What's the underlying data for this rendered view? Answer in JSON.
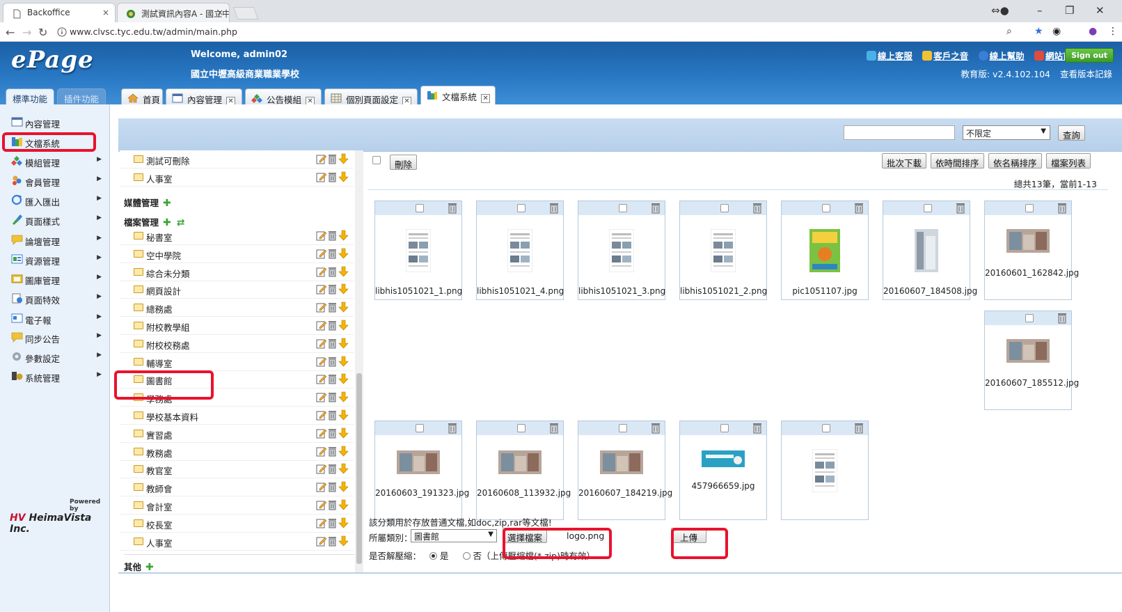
{
  "browser": {
    "tabs": [
      {
        "title": "Backoffice",
        "close": "×"
      },
      {
        "title": "測試資訊內容A - 國立中",
        "close": "×"
      }
    ],
    "url": "www.clvsc.tyc.edu.tw/admin/main.php"
  },
  "header": {
    "logo": "ePage",
    "welcome": "Welcome, admin02",
    "school": "國立中壢高級商業職業學校",
    "links": [
      "線上客服",
      "客戶之音",
      "線上幫助",
      "網站首頁"
    ],
    "signout": "Sign out",
    "version": "教育版: v2.4.102.104",
    "version_log": "查看版本記錄"
  },
  "side_tabs": [
    "標準功能",
    "插件功能"
  ],
  "work_tabs": [
    {
      "label": "首頁",
      "closable": false
    },
    {
      "label": "內容管理",
      "closable": true
    },
    {
      "label": "公告模組",
      "closable": true
    },
    {
      "label": "個別頁面設定",
      "closable": true
    },
    {
      "label": "文檔系統",
      "closable": true
    }
  ],
  "nav": [
    {
      "label": "內容管理",
      "arrow": false
    },
    {
      "label": "文檔系統",
      "arrow": false
    },
    {
      "label": "模組管理",
      "arrow": true
    },
    {
      "label": "會員管理",
      "arrow": true
    },
    {
      "label": "匯入匯出",
      "arrow": true
    },
    {
      "label": "頁面樣式",
      "arrow": true
    },
    {
      "label": "論壇管理",
      "arrow": true
    },
    {
      "label": "資源管理",
      "arrow": true
    },
    {
      "label": "圖庫管理",
      "arrow": true
    },
    {
      "label": "頁面特效",
      "arrow": true
    },
    {
      "label": "電子報",
      "arrow": true
    },
    {
      "label": "同步公告",
      "arrow": true
    },
    {
      "label": "參數設定",
      "arrow": true
    },
    {
      "label": "系統管理",
      "arrow": true
    }
  ],
  "powered": {
    "by": "Powered by",
    "brand": "HeimaVista Inc."
  },
  "toolbar": {
    "search_value": "",
    "scope_value": "不限定",
    "query_label": "查詢"
  },
  "tree": {
    "top_folders": [
      "測試可刪除",
      "人事室"
    ],
    "media_section": "媒體管理",
    "file_section": "檔案管理",
    "file_folders": [
      "秘書室",
      "空中學院",
      "綜合未分類",
      "網頁設計",
      "總務處",
      "附校教學組",
      "附校校務處",
      "輔導室",
      "圖書館",
      "學務處",
      "學校基本資料",
      "實習處",
      "教務處",
      "教官室",
      "教師會",
      "會計室",
      "校長室",
      "人事室"
    ],
    "other_section": "其他"
  },
  "files_toolbar": {
    "delete_label": "刪除",
    "buttons": [
      "批次下載",
      "依時間排序",
      "依名稱排序",
      "檔案列表"
    ],
    "count_text": "總共13筆，當前1-13"
  },
  "files": [
    "libhis1051021_1.png",
    "libhis1051021_4.png",
    "libhis1051021_3.png",
    "libhis1051021_2.png",
    "pic1051107.jpg",
    "20160607_184508.jpg",
    "20160601_162842.jpg",
    "20160607_185512.jpg",
    "20160603_191323.jpg",
    "20160608_113932.jpg",
    "20160607_184219.jpg",
    "457966659.jpg",
    ""
  ],
  "upload": {
    "note": "該分類用於存放普通文檔,如doc,zip,rar等文檔!",
    "category_label": "所屬類別：",
    "category_value": "圖書館",
    "choose_label": "選擇檔案",
    "chosen_file": "logo.png",
    "upload_label": "上傳",
    "decompress_label": "是否解壓縮：",
    "yes_label": "是",
    "no_label": "否（上傳壓縮檔(*.zip)時有效）"
  },
  "colors": {
    "header_blue": "#2a7ac6",
    "highlight_red": "#e8132d",
    "nav_bg": "#e9f1fb"
  }
}
